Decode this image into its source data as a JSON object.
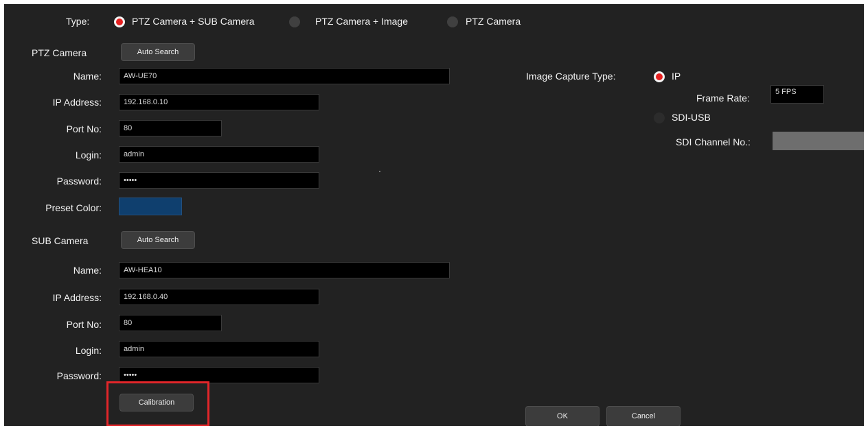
{
  "type_row": {
    "label": "Type:",
    "options": [
      {
        "label": "PTZ Camera + SUB Camera",
        "selected": true
      },
      {
        "label": "PTZ Camera + Image",
        "selected": false
      },
      {
        "label": "PTZ Camera",
        "selected": false
      }
    ]
  },
  "ptz": {
    "section_label": "PTZ Camera",
    "auto_search_label": "Auto Search",
    "name_label": "Name:",
    "name_value": "AW-UE70",
    "ip_label": "IP Address:",
    "ip_value": "192.168.0.10",
    "port_label": "Port No:",
    "port_value": "80",
    "login_label": "Login:",
    "login_value": "admin",
    "password_label": "Password:",
    "password_value": "•••••",
    "preset_color_label": "Preset Color:",
    "preset_color": "#0f3f6e"
  },
  "sub": {
    "section_label": "SUB Camera",
    "auto_search_label": "Auto Search",
    "name_label": "Name:",
    "name_value": "AW-HEA10",
    "ip_label": "IP Address:",
    "ip_value": "192.168.0.40",
    "port_label": "Port No:",
    "port_value": "80",
    "login_label": "Login:",
    "login_value": "admin",
    "password_label": "Password:",
    "password_value": "•••••"
  },
  "image_capture": {
    "label": "Image Capture Type:",
    "ip_option": "IP",
    "ip_selected": true,
    "frame_rate_label": "Frame Rate:",
    "frame_rate_value": "5 FPS",
    "sdi_option": "SDI-USB",
    "sdi_selected": false,
    "sdi_channel_label": "SDI Channel No.:"
  },
  "buttons": {
    "calibration": "Calibration",
    "ok": "OK",
    "cancel": "Cancel"
  },
  "colors": {
    "background": "#222222",
    "radio_selected": "#e62020",
    "highlight": "#e3262a"
  }
}
